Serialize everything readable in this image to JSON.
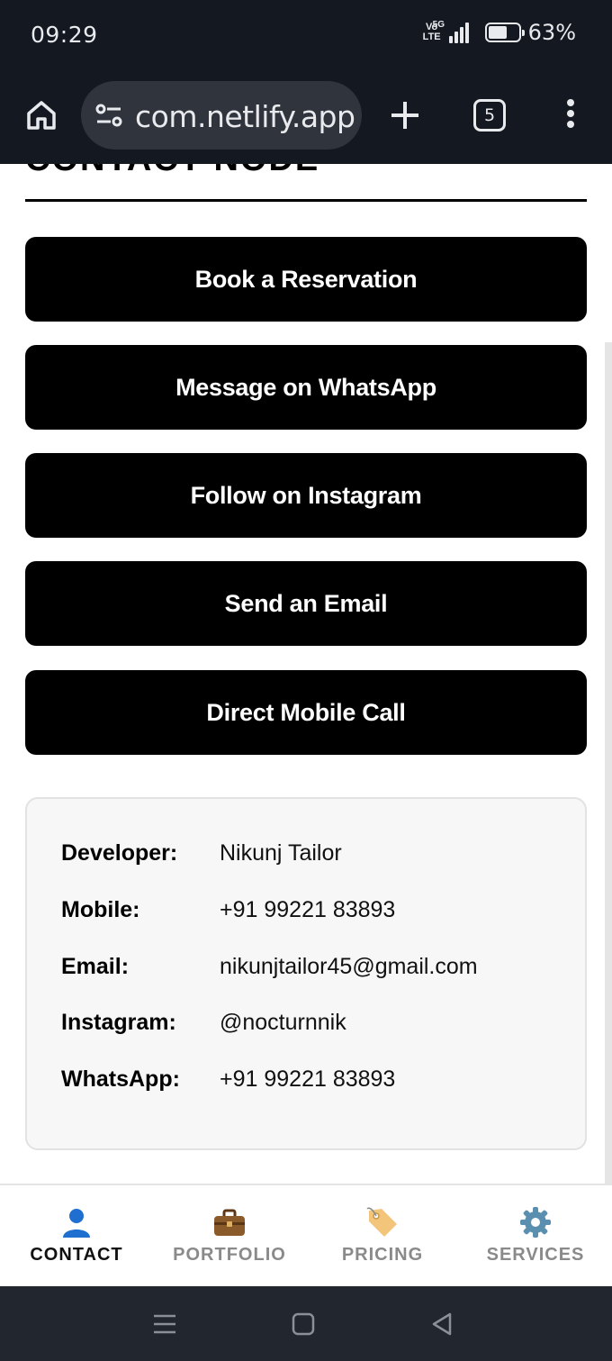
{
  "status_bar": {
    "time": "09:29",
    "volte": "Vo\nLTE",
    "network": "5G",
    "battery_level": 0.63,
    "battery_text": "63%"
  },
  "browser": {
    "url": "com.netlify.app",
    "tab_count": "5",
    "icons": [
      "home-icon",
      "site-settings-icon",
      "plus-icon",
      "tab-switcher-icon",
      "more-vert-icon"
    ]
  },
  "page": {
    "section_title": "CONTACT NODE",
    "buttons": [
      "Book a Reservation",
      "Message on WhatsApp",
      "Follow on Instagram",
      "Send an Email",
      "Direct Mobile Call"
    ],
    "info": [
      {
        "label": "Developer:",
        "value": "Nikunj Tailor"
      },
      {
        "label": "Mobile:",
        "value": "+91 99221 83893"
      },
      {
        "label": "Email:",
        "value": "nikunjtailor45@gmail.com"
      },
      {
        "label": "Instagram:",
        "value": "@nocturnnik"
      },
      {
        "label": "WhatsApp:",
        "value": "+91 99221 83893"
      }
    ]
  },
  "bottom_nav": {
    "items": [
      {
        "label": "CONTACT",
        "icon": "person-icon",
        "active": true
      },
      {
        "label": "PORTFOLIO",
        "icon": "briefcase-icon",
        "active": false
      },
      {
        "label": "PRICING",
        "icon": "tag-icon",
        "active": false
      },
      {
        "label": "SERVICES",
        "icon": "gear-icon",
        "active": false
      }
    ]
  },
  "colors": {
    "chrome_bg": "#141821",
    "url_bar_bg": "#30343d",
    "button_bg": "#000000",
    "button_text": "#ffffff",
    "card_bg": "#f7f7f7",
    "nav_active": "#111111",
    "nav_inactive": "#8a8a8a"
  }
}
